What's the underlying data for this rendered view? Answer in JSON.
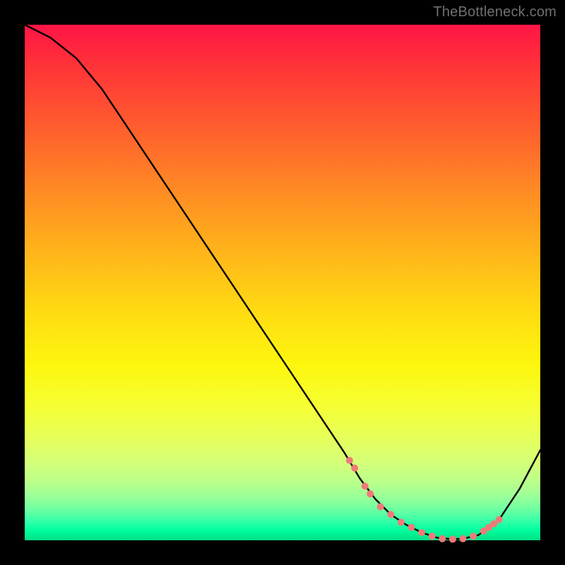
{
  "watermark": "TheBottleneck.com",
  "chart_data": {
    "type": "line",
    "title": "",
    "xlabel": "",
    "ylabel": "",
    "xlim": [
      0,
      100
    ],
    "ylim": [
      0,
      100
    ],
    "grid": false,
    "legend": false,
    "series": [
      {
        "name": "bottleneck-curve",
        "x": [
          0,
          5,
          10,
          15,
          20,
          25,
          30,
          35,
          40,
          45,
          50,
          55,
          60,
          62,
          65,
          68,
          71,
          74,
          77,
          80,
          83,
          85,
          88,
          92,
          96,
          100
        ],
        "y": [
          100,
          97.5,
          93.5,
          87.5,
          80.0,
          72.5,
          65.0,
          57.5,
          50.0,
          42.5,
          35.0,
          27.5,
          20.0,
          17.0,
          12.0,
          8.0,
          5.0,
          3.0,
          1.5,
          0.5,
          0.2,
          0.3,
          1.0,
          4.0,
          10.0,
          17.5
        ]
      }
    ],
    "highlight_points": {
      "name": "flat-region-dots",
      "color": "#ef7a7a",
      "x": [
        63,
        64,
        66,
        67,
        69,
        71,
        73,
        75,
        77,
        79,
        81,
        83,
        85,
        87,
        89,
        90,
        91,
        92
      ],
      "y": [
        15.5,
        14.0,
        10.5,
        9.0,
        6.5,
        5.0,
        3.5,
        2.5,
        1.5,
        0.8,
        0.3,
        0.2,
        0.3,
        0.8,
        1.8,
        2.5,
        3.2,
        4.0
      ]
    },
    "background_gradient": {
      "top_color": "#ff1446",
      "mid_color": "#ffdc12",
      "bottom_color": "#00e083"
    }
  }
}
